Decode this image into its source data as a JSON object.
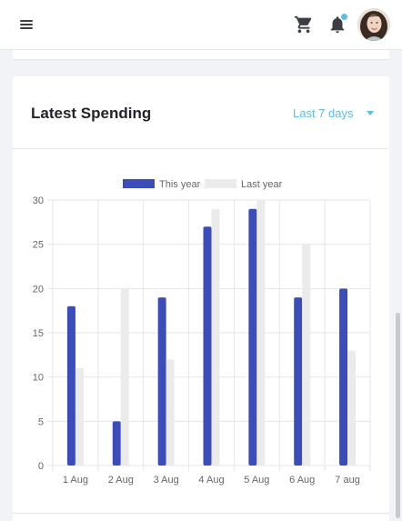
{
  "header": {
    "menu_icon": "hamburger-menu-icon",
    "cart_icon": "shopping-cart-icon",
    "bell_icon": "notification-bell-icon",
    "notification_dot_color": "#5bc0de",
    "avatar": "user-avatar-photo"
  },
  "card": {
    "title": "Latest Spending",
    "period_select": "Last 7 days",
    "period_color": "#5bc0de"
  },
  "colors": {
    "this_year": "#3d4db7",
    "last_year": "#ebebeb",
    "grid": "#e6e6e6",
    "text": "#666666"
  },
  "chart_data": {
    "type": "bar",
    "categories": [
      "1 Aug",
      "2 Aug",
      "3 Aug",
      "4 Aug",
      "5 Aug",
      "6 Aug",
      "7 aug"
    ],
    "series": [
      {
        "name": "This year",
        "values": [
          18,
          5,
          19,
          27,
          29,
          19,
          20
        ]
      },
      {
        "name": "Last year",
        "values": [
          11,
          20,
          12,
          29,
          30,
          25,
          13
        ]
      }
    ],
    "yticks": [
      0,
      5,
      10,
      15,
      20,
      25,
      30
    ],
    "ylim": [
      0,
      30
    ],
    "grid": true,
    "legend": "top-center"
  }
}
